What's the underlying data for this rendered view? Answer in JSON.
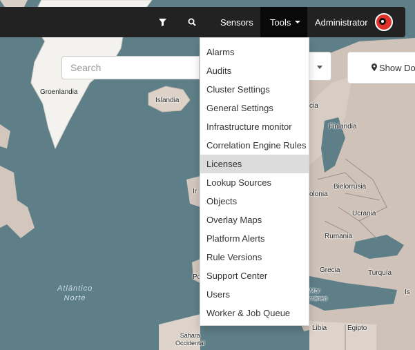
{
  "navbar": {
    "filter_icon": "filter-icon",
    "search_icon": "search-icon",
    "sensors_label": "Sensors",
    "tools_label": "Tools",
    "user_label": "Administrator"
  },
  "search": {
    "placeholder": "Search"
  },
  "show_button": {
    "icon": "map-marker-icon",
    "label": "Show Don"
  },
  "tools_menu": {
    "items": [
      "Alarms",
      "Audits",
      "Cluster Settings",
      "General Settings",
      "Infrastructure monitor",
      "Correlation Engine Rules",
      "Licenses",
      "Lookup Sources",
      "Objects",
      "Overlay Maps",
      "Platform Alerts",
      "Rule Versions",
      "Support Center",
      "Users",
      "Worker & Job Queue"
    ],
    "highlighted_index": 6
  },
  "map": {
    "labels": {
      "groenlandia": "Groenlandia",
      "islandia": "Islandia",
      "finlandia": "Finlandia",
      "bielorrusia": "Bielorrusia",
      "ucrania": "Ucrania",
      "rumania": "Rumania",
      "turquia": "Turquía",
      "grecia": "Grecia",
      "libia": "Libia",
      "egipto": "Egipto",
      "sahara": "Sahara\nOccidental",
      "polonia_partial": "olonia",
      "cia_partial": "cia",
      "ir_partial": "Ir",
      "po_partial": "Po",
      "mar_mediterraneo": "Mar\nrráneo",
      "israel_partial": "Is"
    },
    "ocean": "Atlántico\nNorte"
  }
}
